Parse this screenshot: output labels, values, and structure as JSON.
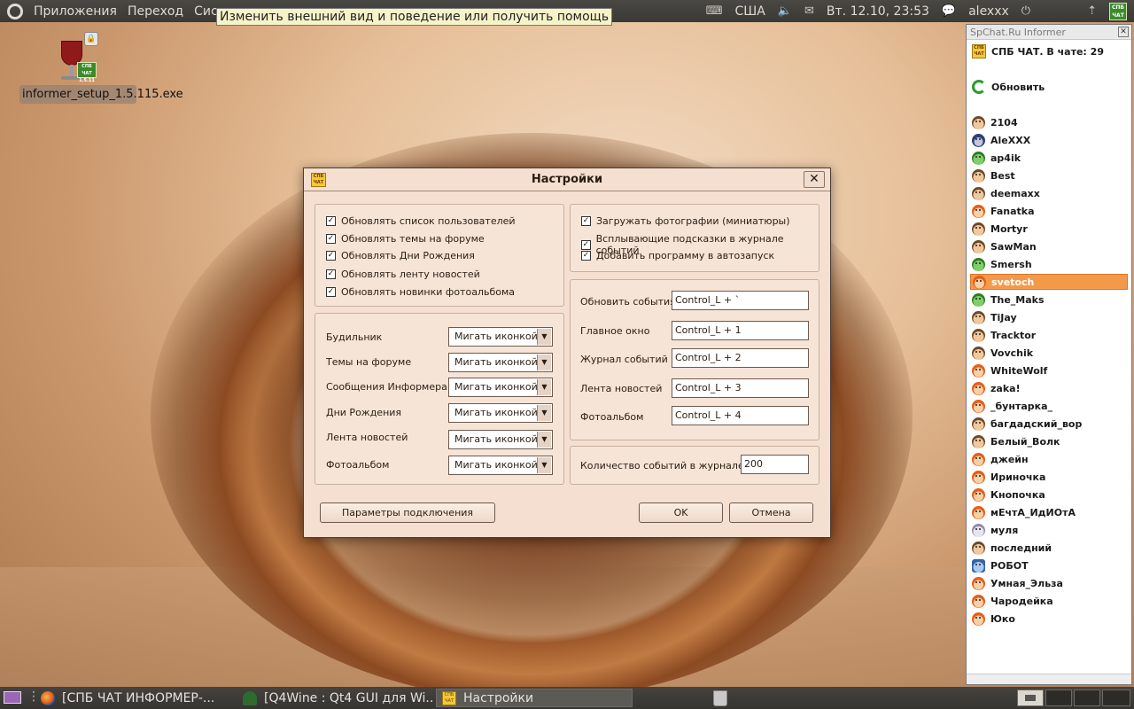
{
  "top_panel": {
    "menu": [
      "Приложения",
      "Переход",
      "Сист"
    ],
    "tooltip": "Изменить внешний вид и поведение или получить помощь",
    "keyboard_layout": "США",
    "datetime": "Вт. 12.10, 23:53",
    "user": "alexxx",
    "tray_app_label": "СПБ ЧАТ"
  },
  "desktop": {
    "icon": {
      "label": "informer_setup_1.5.115.exe",
      "version_badge": "1.5.11",
      "badge_text": "СПБ ЧАТ"
    }
  },
  "dialog": {
    "title": "Настройки",
    "icon_text": "СПБ ЧАТ",
    "left_checks": [
      {
        "label": "Обновлять список пользователей",
        "checked": true
      },
      {
        "label": "Обновлять темы на форуме",
        "checked": true
      },
      {
        "label": "Обновлять Дни Рождения",
        "checked": true
      },
      {
        "label": "Обновлять ленту новостей",
        "checked": true
      },
      {
        "label": "Обновлять новинки фотоальбома",
        "checked": true
      }
    ],
    "right_checks": [
      {
        "label": "Загружать  фотографии (миниатюры)",
        "checked": true
      },
      {
        "label": "Всплывающие подсказки в журнале событий",
        "checked": true
      },
      {
        "label": "Добавить программу в автозапуск",
        "checked": true
      }
    ],
    "notifications": [
      {
        "label": "Будильник",
        "value": "Мигать иконкой"
      },
      {
        "label": "Темы на форуме",
        "value": "Мигать иконкой"
      },
      {
        "label": "Сообщения Информера",
        "value": "Мигать иконкой"
      },
      {
        "label": "Дни Рождения",
        "value": "Мигать иконкой"
      },
      {
        "label": "Лента новостей",
        "value": "Мигать иконкой"
      },
      {
        "label": "Фотоальбом",
        "value": "Мигать иконкой"
      }
    ],
    "hotkeys": [
      {
        "label": "Обновить события",
        "value": "Control_L + `"
      },
      {
        "label": "Главное окно",
        "value": "Control_L + 1"
      },
      {
        "label": "Журнал событий",
        "value": "Control_L + 2"
      },
      {
        "label": "Лента новостей",
        "value": "Control_L + 3"
      },
      {
        "label": "Фотоальбом",
        "value": "Control_L + 4"
      }
    ],
    "journal_count": {
      "label": "Количество событий в журнале",
      "value": "200"
    },
    "buttons": {
      "connection": "Параметры подключения",
      "ok": "OK",
      "cancel": "Отмена"
    }
  },
  "sidebar": {
    "title": "SpChat.Ru Informer",
    "header": "СПБ ЧАТ. В чате: 29",
    "refresh": "Обновить",
    "users": [
      {
        "name": "2104",
        "avatar": "m"
      },
      {
        "name": "AleXXX",
        "avatar": "b"
      },
      {
        "name": "ap4ik",
        "avatar": "a"
      },
      {
        "name": "Best",
        "avatar": "m"
      },
      {
        "name": "deemaxx",
        "avatar": "m"
      },
      {
        "name": "Fanatka",
        "avatar": "f"
      },
      {
        "name": "Mortyr",
        "avatar": "m"
      },
      {
        "name": "SawMan",
        "avatar": "m"
      },
      {
        "name": "Smersh",
        "avatar": "a"
      },
      {
        "name": "svetoch",
        "avatar": "f",
        "selected": true
      },
      {
        "name": "The_Maks",
        "avatar": "a"
      },
      {
        "name": "TiJay",
        "avatar": "m"
      },
      {
        "name": "Tracktor",
        "avatar": "m"
      },
      {
        "name": "Vovchik",
        "avatar": "m"
      },
      {
        "name": "WhiteWolf",
        "avatar": "f"
      },
      {
        "name": "zaka!",
        "avatar": "f"
      },
      {
        "name": "_бунтарка_",
        "avatar": "f"
      },
      {
        "name": "багдадский_вор",
        "avatar": "m"
      },
      {
        "name": "Белый_Волк",
        "avatar": "m"
      },
      {
        "name": "джейн",
        "avatar": "f"
      },
      {
        "name": "Ириночка",
        "avatar": "f"
      },
      {
        "name": "Кнопочка",
        "avatar": "f"
      },
      {
        "name": "мЕчтА_ИдИОтА",
        "avatar": "f"
      },
      {
        "name": "муля",
        "avatar": "g"
      },
      {
        "name": "последний",
        "avatar": "m"
      },
      {
        "name": "РОБОТ",
        "avatar": "r"
      },
      {
        "name": "Умная_Эльза",
        "avatar": "f"
      },
      {
        "name": "Чародейка",
        "avatar": "f"
      },
      {
        "name": "Юко",
        "avatar": "f"
      }
    ]
  },
  "taskbar": {
    "items": [
      {
        "label": "[СПБ ЧАТ ИНФОРМЕР-...",
        "icon": "firefox-icon"
      },
      {
        "label": "[Q4Wine : Qt4 GUI для Wi...",
        "icon": "wine-icon"
      },
      {
        "label": "Настройки",
        "icon": "spbchat-icon",
        "active": true
      }
    ]
  }
}
